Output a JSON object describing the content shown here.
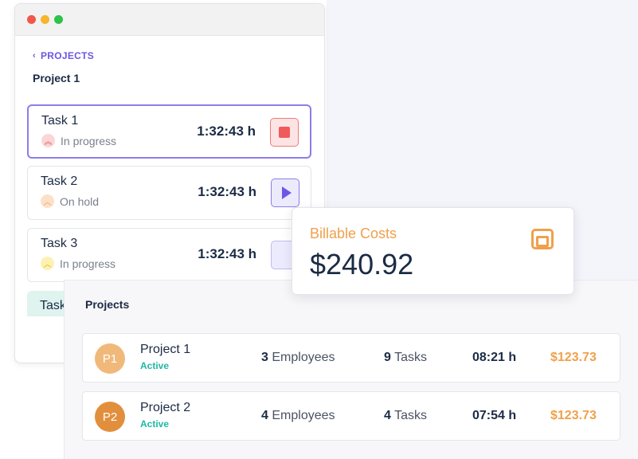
{
  "window": {
    "back_label": "PROJECTS",
    "project_title": "Project 1",
    "tasks": [
      {
        "name": "Task 1",
        "status": "In progress",
        "time": "1:32:43 h",
        "status_icon": "double-chevron-up-icon",
        "action": "stop"
      },
      {
        "name": "Task 2",
        "status": "On hold",
        "time": "1:32:43 h",
        "status_icon": "chevron-up-icon",
        "action": "play"
      },
      {
        "name": "Task 3",
        "status": "In progress",
        "time": "1:32:43 h",
        "status_icon": "chevron-up-icon",
        "action": "play"
      }
    ],
    "task4_partial": "Task"
  },
  "billable": {
    "label": "Billable Costs",
    "amount": "$240.92",
    "icon": "wallet-icon"
  },
  "projects": {
    "title": "Projects",
    "rows": [
      {
        "avatar": "P1",
        "name": "Project 1",
        "status": "Active",
        "employees_count": "3",
        "employees_label": "Employees",
        "tasks_count": "9",
        "tasks_label": "Tasks",
        "hours": "08:21 h",
        "cost": "$123.73"
      },
      {
        "avatar": "P2",
        "name": "Project 2",
        "status": "Active",
        "employees_count": "4",
        "employees_label": "Employees",
        "tasks_count": "4",
        "tasks_label": "Tasks",
        "hours": "07:54 h",
        "cost": "$123.73"
      }
    ]
  },
  "colors": {
    "accent": "#6b57e0",
    "orange": "#f0a04b",
    "teal": "#1fb8a3",
    "stop_red": "#f05a5a"
  }
}
